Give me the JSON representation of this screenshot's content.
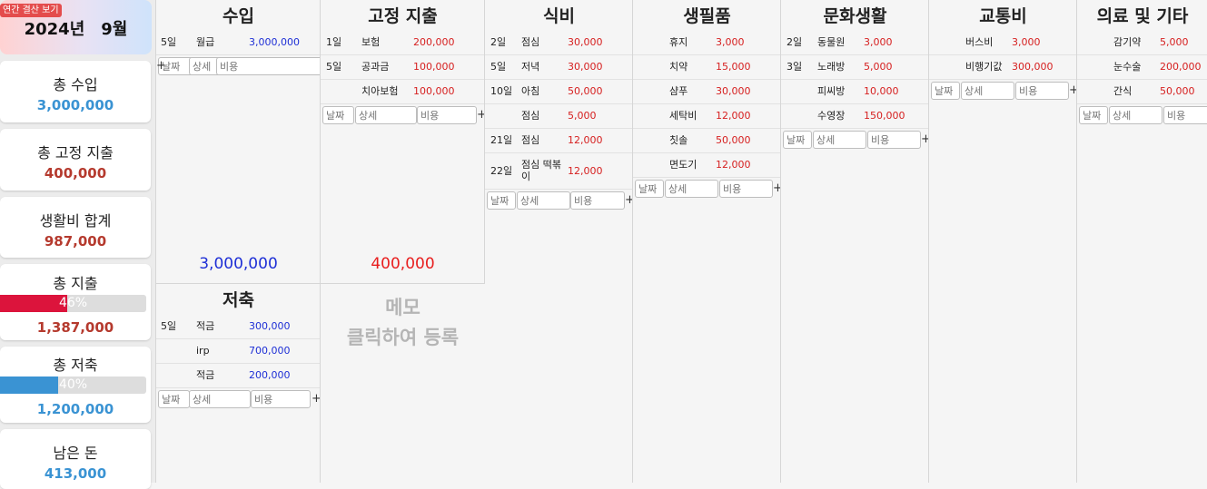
{
  "header": {
    "badge": "연간 결산 보기",
    "year": "2024년",
    "month": "9월"
  },
  "summary": {
    "income": {
      "label": "총 수입",
      "value": "3,000,000"
    },
    "fixed": {
      "label": "총 고정 지출",
      "value": "400,000"
    },
    "living": {
      "label": "생활비 합계",
      "value": "987,000"
    },
    "spend": {
      "label": "총 지출",
      "percent": "46%",
      "ratio": 0.46,
      "value": "1,387,000",
      "bar_color": "#dc143c"
    },
    "saving": {
      "label": "총 저축",
      "percent": "40%",
      "ratio": 0.4,
      "value": "1,200,000",
      "bar_color": "#3a93d3"
    },
    "left": {
      "label": "남은 돈",
      "value": "413,000"
    }
  },
  "form": {
    "date_ph": "날짜",
    "detail_ph": "상세",
    "cost_ph": "비용",
    "add": "+"
  },
  "categories": {
    "income": {
      "title": "수입",
      "total": "3,000,000",
      "rows": [
        {
          "date": "5일",
          "detail": "월급",
          "amount": "3,000,000"
        }
      ]
    },
    "fixed": {
      "title": "고정 지출",
      "total": "400,000",
      "rows": [
        {
          "date": "1일",
          "detail": "보험",
          "amount": "200,000"
        },
        {
          "date": "5일",
          "detail": "공과금",
          "amount": "100,000"
        },
        {
          "date": "",
          "detail": "치아보험",
          "amount": "100,000"
        }
      ]
    },
    "food": {
      "title": "식비",
      "rows": [
        {
          "date": "2일",
          "detail": "점심",
          "amount": "30,000"
        },
        {
          "date": "5일",
          "detail": "저녁",
          "amount": "30,000"
        },
        {
          "date": "10일",
          "detail": "아침",
          "amount": "50,000"
        },
        {
          "date": "",
          "detail": "점심",
          "amount": "5,000"
        },
        {
          "date": "21일",
          "detail": "점심",
          "amount": "12,000"
        },
        {
          "date": "22일",
          "detail": "점심 떡볶이",
          "amount": "12,000"
        }
      ]
    },
    "daily": {
      "title": "생필품",
      "rows": [
        {
          "date": "",
          "detail": "휴지",
          "amount": "3,000"
        },
        {
          "date": "",
          "detail": "치약",
          "amount": "15,000"
        },
        {
          "date": "",
          "detail": "샴푸",
          "amount": "30,000"
        },
        {
          "date": "",
          "detail": "세탁비",
          "amount": "12,000"
        },
        {
          "date": "",
          "detail": "칫솔",
          "amount": "50,000"
        },
        {
          "date": "",
          "detail": "면도기",
          "amount": "12,000"
        }
      ]
    },
    "culture": {
      "title": "문화생활",
      "rows": [
        {
          "date": "2일",
          "detail": "동물원",
          "amount": "3,000"
        },
        {
          "date": "3일",
          "detail": "노래방",
          "amount": "5,000"
        },
        {
          "date": "",
          "detail": "피씨방",
          "amount": "10,000"
        },
        {
          "date": "",
          "detail": "수영장",
          "amount": "150,000"
        }
      ]
    },
    "transport": {
      "title": "교통비",
      "rows": [
        {
          "date": "",
          "detail": "버스비",
          "amount": "3,000"
        },
        {
          "date": "",
          "detail": "비행기값",
          "amount": "300,000"
        }
      ]
    },
    "medical": {
      "title": "의료 및 기타",
      "rows": [
        {
          "date": "",
          "detail": "감기약",
          "amount": "5,000"
        },
        {
          "date": "",
          "detail": "눈수술",
          "amount": "200,000"
        },
        {
          "date": "",
          "detail": "간식",
          "amount": "50,000"
        }
      ]
    },
    "savings": {
      "title": "저축",
      "rows": [
        {
          "date": "5일",
          "detail": "적금",
          "amount": "300,000"
        },
        {
          "date": "",
          "detail": "irp",
          "amount": "700,000"
        },
        {
          "date": "",
          "detail": "적금",
          "amount": "200,000"
        }
      ]
    }
  },
  "memo": {
    "title": "메모",
    "hint": "클릭하여 등록"
  }
}
